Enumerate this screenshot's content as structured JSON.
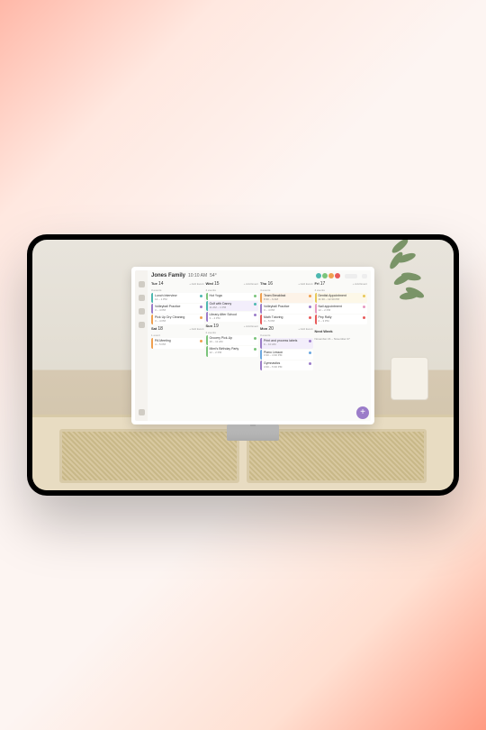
{
  "header": {
    "family": "Jones Family",
    "time": "10:10 AM",
    "temp": "54°"
  },
  "days": [
    {
      "label": "Tue",
      "num": "14",
      "add": "+ Add Event",
      "count": "3 events",
      "events": [
        {
          "title": "Lunch Interview",
          "time": "12 – 1 PM",
          "color": "teal"
        },
        {
          "title": "Volleyball Practice",
          "time": "3 – 4 PM",
          "color": "purple"
        },
        {
          "title": "Pick Up Dry Cleaning",
          "time": "3 – 4 PM",
          "color": "orange"
        }
      ]
    },
    {
      "label": "Wed",
      "num": "15",
      "add": "+ Add Event",
      "count": "4 events",
      "events": [
        {
          "title": "Hot Yoga",
          "time": "",
          "color": "green"
        },
        {
          "title": "Golf with Danny",
          "time": "11 AM – 1 PM",
          "color": "teal",
          "shade": "shade"
        },
        {
          "title": "Library After School",
          "time": "3 – 4 PM",
          "color": "purple"
        }
      ]
    },
    {
      "label": "Thu",
      "num": "16",
      "add": "+ Add Event",
      "count": "4 events",
      "events": [
        {
          "title": "Team Breakfast",
          "time": "8:30 – 9 AM",
          "color": "orange",
          "shade": "shadeO"
        },
        {
          "title": "Volleyball Practice",
          "time": "3 – 4 PM",
          "color": "purple"
        },
        {
          "title": "Math Tutoring",
          "time": "4 – 5 PM",
          "color": "red"
        }
      ]
    },
    {
      "label": "Fri",
      "num": "17",
      "add": "+ Add Event",
      "count": "4 events",
      "events": [
        {
          "title": "Dentist Appointment",
          "time": "11:30 – 12:30 PM",
          "color": "yellow",
          "shade": "shadeY"
        },
        {
          "title": "Nail appointment",
          "time": "12 – 2 PM",
          "color": "pink"
        },
        {
          "title": "Pep Rally",
          "time": "2 – 3 PM",
          "color": "red"
        }
      ],
      "next": "Next Week",
      "nextrange": "November 21 – November 27"
    },
    {
      "label": "Sat",
      "num": "18",
      "add": "+ Add Event",
      "count": "1 event",
      "events": [
        {
          "title": "PA Meeting",
          "time": "4 – 5 PM",
          "color": "orange"
        }
      ]
    },
    {
      "label": "Sun",
      "num": "19",
      "add": "+ Add Event",
      "count": "2 events",
      "events": [
        {
          "title": "Grocery Pick-Up",
          "time": "10 – 11 AM",
          "color": "green"
        },
        {
          "title": "Mimi's Birthday Party",
          "time": "12 – 2 PM",
          "color": "green"
        }
      ]
    },
    {
      "label": "Mon",
      "num": "20",
      "add": "+ Add Event",
      "count": "3 events",
      "events": [
        {
          "title": "Print and process labels",
          "time": "9 – 10 AM",
          "color": "purple",
          "shade": "shade"
        },
        {
          "title": "Piano Lesson",
          "time": "3:30 – 4:30 PM",
          "color": "blue"
        },
        {
          "title": "Gymnastics",
          "time": "4:30 – 5:30 PM",
          "color": "purple"
        }
      ]
    }
  ]
}
